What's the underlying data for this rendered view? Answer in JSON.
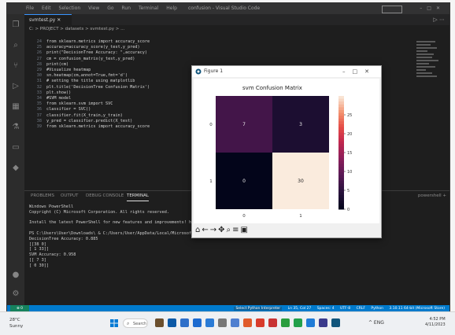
{
  "vscode": {
    "menus": [
      "File",
      "Edit",
      "Selection",
      "View",
      "Go",
      "Run",
      "Terminal",
      "Help"
    ],
    "window_title": "confusion - Visual Studio Code",
    "tab_label": "svmtest.py",
    "breadcrumb": "C: > PROJECT > datasets > svmtest.py > ...",
    "code_lines": [
      {
        "n": "24",
        "text": "from sklearn.metrics import accuracy_score"
      },
      {
        "n": "25",
        "text": "accuracy=accuracy_score(y_test,y_pred)"
      },
      {
        "n": "26",
        "text": "print(\"DecisionTree Accuracy: \",accuracy)"
      },
      {
        "n": "27",
        "text": "cm = confusion_matrix(y_test,y_pred)"
      },
      {
        "n": "28",
        "text": "print(cm)"
      },
      {
        "n": "29",
        "text": "#Visualize heatmap"
      },
      {
        "n": "30",
        "text": "sn.heatmap(cm,annot=True,fmt='d')"
      },
      {
        "n": "31",
        "text": "# setting the title using matplotlib"
      },
      {
        "n": "32",
        "text": "plt.title('DecisionTree Confusion Matrix')"
      },
      {
        "n": "33",
        "text": "plt.show()"
      },
      {
        "n": "34",
        "text": "#SVM model"
      },
      {
        "n": "35",
        "text": "from sklearn.svm import SVC"
      },
      {
        "n": "36",
        "text": "classifier = SVC()"
      },
      {
        "n": "37",
        "text": "classifier.fit(X_train,y_train)"
      },
      {
        "n": "38",
        "text": "y_pred = classifier.predict(X_test)"
      },
      {
        "n": "39",
        "text": "from sklearn.metrics import accuracy_score"
      }
    ],
    "panel_tabs": [
      "PROBLEMS",
      "OUTPUT",
      "DEBUG CONSOLE",
      "TERMINAL"
    ],
    "panel_right": "powershell +",
    "terminal_lines": [
      "Windows PowerShell",
      "Copyright (C) Microsoft Corporation. All rights reserved.",
      "",
      "Install the latest PowerShell for new features and improvements! https://aka.ms/PSWindows",
      "",
      "PS C:\\Users\\User\\Downloads\\ & C:/Users/User/AppData/Local/Microsoft/WindowsApps/python3.10.exe c:/PROJECT/datasets/svmtest.py",
      "DecisionTree Accuracy: 0.885",
      "[[38  0]",
      " [ 1 33]]",
      "SVM Accuracy: 0.958",
      "[[ 7  3]",
      " [ 0 30]]"
    ],
    "status_left": "⊗ 0",
    "status_right": [
      "Ln 35, Col 27",
      "Spaces: 4",
      "UTF-8",
      "CRLF",
      "Python",
      "3.10.11 64-bit (Microsoft Store)"
    ],
    "status_highlight": "Select Python Interpreter"
  },
  "figure_window": {
    "title": "Figure 1",
    "toolbar_icons": [
      "home-icon",
      "back-icon",
      "forward-icon",
      "pan-icon",
      "zoom-icon",
      "configure-icon",
      "save-icon"
    ]
  },
  "chart_data": {
    "type": "heatmap",
    "title": "svm Confusion Matrix",
    "x_tick_labels": [
      "0",
      "1"
    ],
    "y_tick_labels": [
      "0",
      "1"
    ],
    "values": [
      [
        7,
        3
      ],
      [
        0,
        30
      ]
    ],
    "colorbar_ticks": [
      0,
      5,
      10,
      15,
      20,
      25
    ],
    "colorbar_range": [
      0,
      30
    ],
    "colormap": "rocket"
  },
  "taskbar": {
    "weather_temp": "28°C",
    "weather_desc": "Sunny",
    "search_label": "Search",
    "clock_time": "4:52 PM",
    "clock_date": "4/11/2023",
    "tray_text": "^ ENG"
  }
}
